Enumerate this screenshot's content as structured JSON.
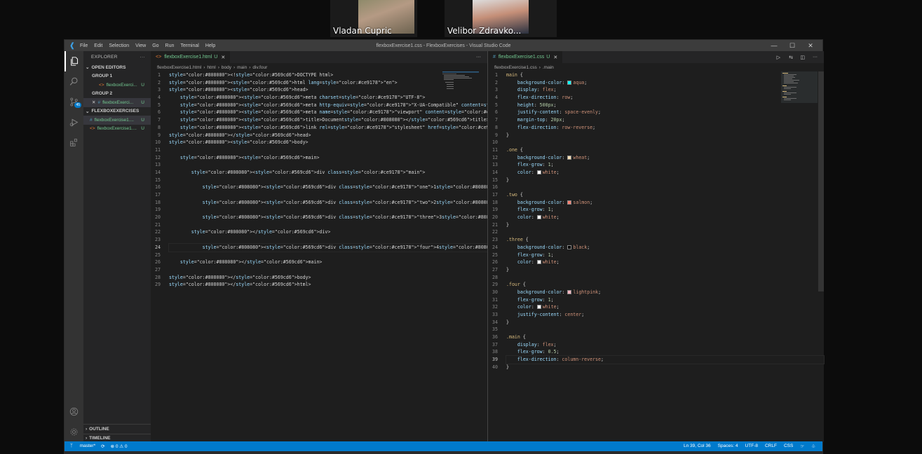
{
  "meeting": {
    "participants": [
      {
        "name": "Vladan Cupric"
      },
      {
        "name": "Velibor Zdravko..."
      }
    ]
  },
  "window": {
    "title": "flexboxExercise1.css - FlexboxExercises - Visual Studio Code",
    "menu": [
      "File",
      "Edit",
      "Selection",
      "View",
      "Go",
      "Run",
      "Terminal",
      "Help"
    ],
    "controls": {
      "minimize": "—",
      "maximize": "☐",
      "close": "✕"
    }
  },
  "activity": {
    "scm_badge": "45"
  },
  "explorer": {
    "header": "EXPLORER",
    "open_editors": "OPEN EDITORS",
    "group1": "GROUP 1",
    "group1_file": "flexboxExerci...",
    "group1_status": "U",
    "group2": "GROUP 2",
    "group2_file": "flexboxExerci...",
    "group2_status": "U",
    "project": "FLEXBOXEXERCISES",
    "file_css": "flexboxExercise1....",
    "file_css_status": "U",
    "file_html": "flexboxExercise1....",
    "file_html_status": "U",
    "outline": "OUTLINE",
    "timeline": "TIMELINE"
  },
  "left_editor": {
    "tab": "flexboxExercise1.html",
    "tab_status": "U",
    "breadcrumb": [
      "flexboxExercise1.html",
      "html",
      "body",
      "main",
      "div.four"
    ],
    "lines": [
      "<!DOCTYPE html>",
      "<html lang=\"en\">",
      "<head>",
      "    <meta charset=\"UTF-8\">",
      "    <meta http-equiv=\"X-UA-Compatible\" content=\"IE=edge\">",
      "    <meta name=\"viewport\" content=\"width=device-width, initial-scale=1.0\">",
      "    <title>Document</title>",
      "    <link rel=\"stylesheet\" href=\"flexboxExercise1.css\">",
      "</head>",
      "<body>",
      "",
      "    <main>",
      "",
      "        <div class=\"main\">",
      "",
      "            <div class=\"one\">1</div>",
      "",
      "            <div class=\"two\">2</div>",
      "",
      "            <div class=\"three\">3</div>",
      "",
      "        </div>",
      "",
      "            <div class=\"four\">4</div>",
      "",
      "    </main>",
      "",
      "</body>",
      "</html>"
    ]
  },
  "right_editor": {
    "tab": "flexboxExercise1.css",
    "tab_status": "U",
    "breadcrumb": [
      "flexboxExercise1.css",
      ".main"
    ],
    "lines": [
      "main {",
      "    background-color: aqua;",
      "    display: flex;",
      "    flex-direction: row;",
      "    height: 500px;",
      "    justify-content: space-evenly;",
      "    margin-top: 20px;",
      "    flex-direction: row-reverse;",
      "}",
      "",
      ".one {",
      "    background-color: wheat;",
      "    flex-grow: 1;",
      "    color: white;",
      "}",
      "",
      ".two {",
      "    background-color: salmon;",
      "    flex-grow: 1;",
      "    color: white;",
      "}",
      "",
      ".three {",
      "    background-color: black;",
      "    flex-grow: 1;",
      "    color: white;",
      "}",
      "",
      ".four {",
      "    background-color: lightpink;",
      "    flex-grow: 1;",
      "    color: white;",
      "    justify-content: center;",
      "}",
      "",
      ".main {",
      "    display: flex;",
      "    flex-grow: 0.5;",
      "    flex-direction: column-reverse;",
      "}"
    ]
  },
  "status": {
    "branch": "master*",
    "problems": "⊗ 0 ⚠ 0",
    "position": "Ln 39, Col 36",
    "spaces": "Spaces: 4",
    "encoding": "UTF-8",
    "eol": "CRLF",
    "language": "CSS"
  },
  "colors": {
    "accent": "#007acc",
    "tag": "#569cd6",
    "attr": "#9cdcfe",
    "string": "#ce9178",
    "selector": "#d7ba7d",
    "untracked": "#73c991",
    "aqua": "#00ffff",
    "wheat": "#f5deb3",
    "salmon": "#fa8072",
    "black": "#000000",
    "lightpink": "#ffb6c1",
    "white": "#ffffff"
  }
}
